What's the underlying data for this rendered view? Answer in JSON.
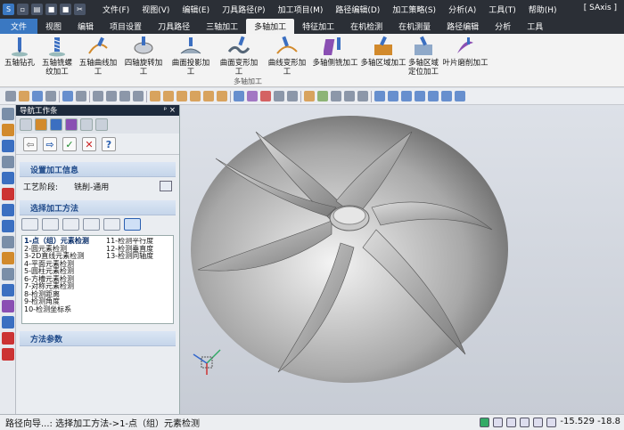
{
  "titlebar": {
    "app_name": "[ SAxis ]",
    "menus": [
      "文件(F)",
      "视图(V)",
      "编辑(E)",
      "刀具路径(P)",
      "加工项目(M)",
      "路径编辑(D)",
      "加工策略(S)",
      "分析(A)",
      "工具(T)",
      "帮助(H)"
    ]
  },
  "ribbon_tabs": [
    "文件",
    "视图",
    "编辑",
    "项目设置",
    "刀具路径",
    "三轴加工",
    "多轴加工",
    "特征加工",
    "在机检测",
    "在机测量",
    "路径编辑",
    "分析",
    "工具"
  ],
  "ribbon_buttons": [
    "五轴钻孔",
    "五轴铣螺\n纹加工",
    "五轴曲线加工",
    "四轴旋转加工",
    "曲面投影加工",
    "曲面变形加工",
    "曲线变形加工",
    "多轴侧铣加工",
    "多轴区域加工",
    "多轴区域\n定位加工",
    "叶片磨削加工"
  ],
  "ribbon_group_label": "多轴加工",
  "panel": {
    "title": "导航工作条",
    "pin": "ᵖ ×",
    "section1": "设置加工信息",
    "process_label": "工艺阶段:",
    "process_value": "铣削-通用",
    "section2": "选择加工方法",
    "methods_left": [
      "1-点（组）元素检测",
      "2-圆元素检测",
      "3-2D直线元素检测",
      "4-平面元素检测",
      "5-圆柱元素检测",
      "6-方槽元素检测",
      "7-对称元素检测",
      "8-检测距离",
      "9-检测角度",
      "10-检测坐标系"
    ],
    "methods_right": [
      "11-检测平行度",
      "12-检测垂直度",
      "13-检测同轴度"
    ],
    "section3": "方法参数"
  },
  "status": {
    "text": "路径向导...: 选择加工方法->1-点（组）元素检测",
    "coords": "-15.529  -18.8"
  },
  "colors": {
    "accent": "#3a78c2",
    "dark": "#2b2f36",
    "section_text": "#1f4a8a"
  }
}
